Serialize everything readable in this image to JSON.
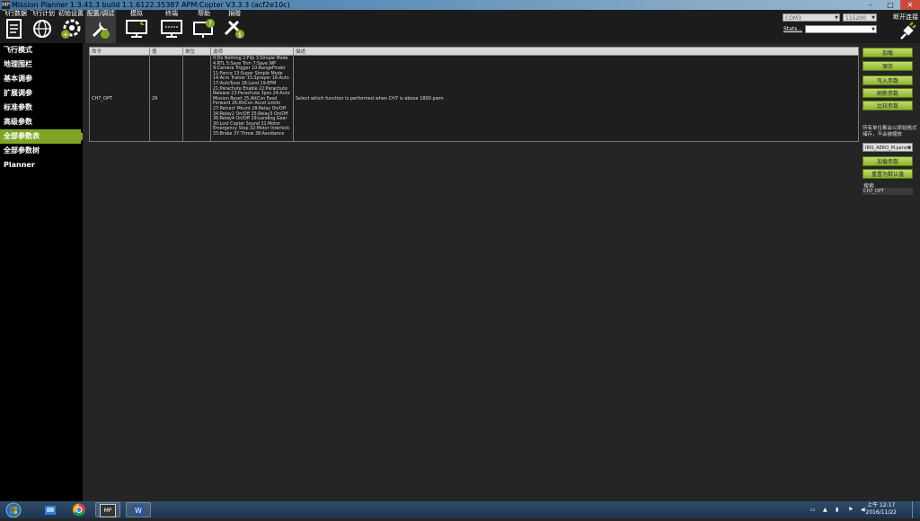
{
  "window": {
    "title": "Mission Planner 1.3.41.3 build 1.1.6122.35387 APM:Copter V3.3.3 (acf2e10c)",
    "app_icon": "MP",
    "controls": [
      "–",
      "□",
      "✕"
    ]
  },
  "toolbar": {
    "items": [
      {
        "label": "飞行数据",
        "icon": "flight-data-icon"
      },
      {
        "label": "飞行计划",
        "icon": "flight-plan-icon"
      },
      {
        "label": "初始设置",
        "icon": "initial-setup-icon"
      },
      {
        "label": "配置/调试",
        "icon": "config-tuning-icon"
      },
      {
        "label": "模拟",
        "icon": "simulation-icon"
      },
      {
        "label": "终端",
        "icon": "terminal-icon"
      },
      {
        "label": "帮助",
        "icon": "help-icon"
      },
      {
        "label": "捐赠",
        "icon": "donate-icon"
      }
    ],
    "active_index": 3,
    "connection": {
      "port": "COM3",
      "baud": "115200",
      "stats_label": "Stats...",
      "disconnect_label": "断开连接"
    }
  },
  "sidebar": {
    "items": [
      {
        "label": "飞行模式"
      },
      {
        "label": "地理围栏"
      },
      {
        "label": "基本调参"
      },
      {
        "label": "扩展调参"
      },
      {
        "label": "标准参数"
      },
      {
        "label": "高级参数"
      },
      {
        "label": "全部参数表"
      },
      {
        "label": "全部参数树"
      },
      {
        "label": "Planner"
      }
    ],
    "active_index": 6
  },
  "param_table": {
    "headers": [
      "命令",
      "值",
      "单位",
      "选项",
      "描述"
    ],
    "rows": [
      {
        "command": "CH7_OPT",
        "value": "29",
        "unit": "",
        "options": "0:Do Nothing  2:Flip  3:Simple Mode\n4:RTL  5:Save Trim  7:Save WP\n9:Camera Trigger  10:RangeFinder\n11:Fence  13:Super Simple Mode\n14:Acro Trainer  15:Sprayer  16:Auto\n17:AutoTune  18:Land  19:EPM\n21:Parachute Enable  22:Parachute\nRelease  23:Parachute 3pos  24:Auto\nMission Reset  25:AttCon Feed\nForward  26:AttCon Accel Limits\n27:Retract Mount  28:Relay On/Off\n34:Relay2 On/Off  35:Relay3 On/Off\n36:Relay4 On/Off  29:Landing Gear\n30:Lost Copter Sound  31:Motor\nEmergency Stop  32:Motor Interlock\n33:Brake  37:Throw  38:Avoidance",
        "description": "Select which function is performed when CH7 is above 1800 pwm"
      }
    ]
  },
  "right_panel": {
    "buttons": [
      "加载",
      "保存",
      "写入参数",
      "刷新参数",
      "比较参数"
    ],
    "note": "所有单位都会以原始格式储存，不会被缩放",
    "param_file": "IRIS_AERO_M.param",
    "file_buttons": [
      "加载参数",
      "重置为默认值"
    ],
    "search_label": "搜索",
    "search_value": "CH7_OPT"
  },
  "taskbar": {
    "apps": [
      "start-orb-icon",
      "explorer-icon",
      "folder-icon",
      "chrome-icon",
      "mission-planner-icon",
      "word-icon"
    ],
    "mp_label": "MP",
    "time": "上午 12:17",
    "date": "2016/11/22"
  },
  "colors": {
    "accent_green": "#7fa524",
    "button_green": "#a6c94b",
    "toolbar_bg": "#1c1c1c",
    "main_bg": "#252525"
  }
}
